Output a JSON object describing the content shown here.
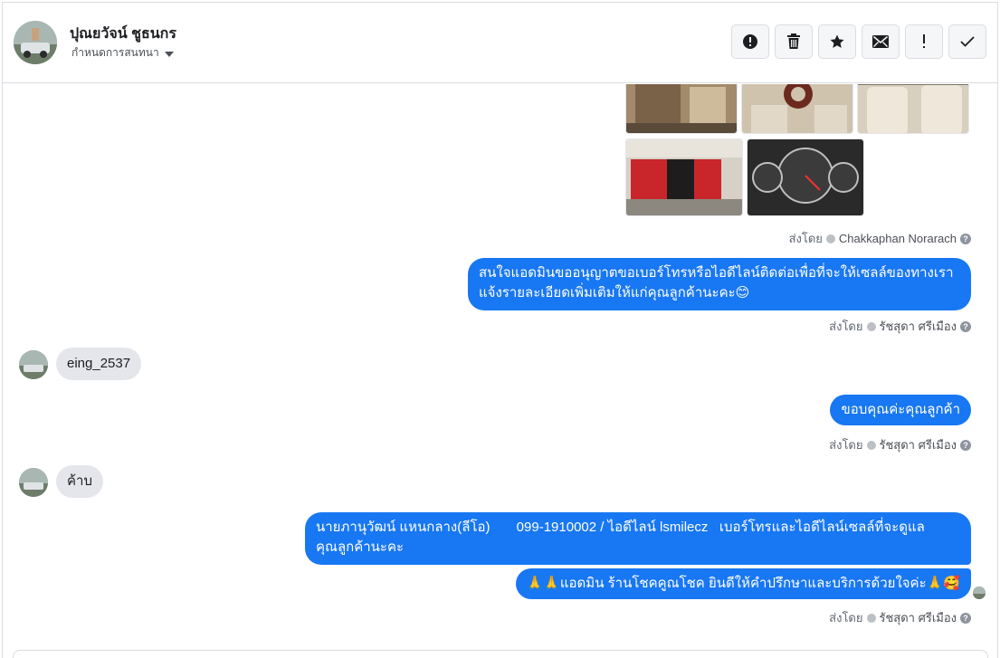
{
  "header": {
    "contact_name": "ปุณยวัจน์ ชูธนกร",
    "assign_label": "กำหนดการสนทนา"
  },
  "toolbar": {
    "buttons": [
      {
        "icon": "alert-circle-icon",
        "name": "mark-spam-button"
      },
      {
        "icon": "trash-icon",
        "name": "delete-button"
      },
      {
        "icon": "star-icon",
        "name": "star-button"
      },
      {
        "icon": "envelope-icon",
        "name": "mark-unread-button"
      },
      {
        "icon": "exclamation-icon",
        "name": "follow-up-button"
      },
      {
        "icon": "check-icon",
        "name": "mark-done-button"
      }
    ]
  },
  "thread": {
    "photo_sentby": {
      "prefix": "ส่งโดย",
      "agent": "Chakkaphan Norarach"
    },
    "msg1": {
      "line1": "สนใจแอดมินขออนุญาตขอเบอร์โทรหรือไอดีไลน์ติดต่อเพื่อที่จะให้เซลล์ของทางเรา",
      "line2": "แจ้งรายละเอียดเพิ่มเติมให้แก่คุณลูกค้านะคะ😊"
    },
    "msg1_sentby": {
      "prefix": "ส่งโดย",
      "agent": "รัชสุดา ศรีเมือง"
    },
    "in1": "eing_2537",
    "msg2": "ขอบคุณค่ะคุณลูกค้า",
    "msg2_sentby": {
      "prefix": "ส่งโดย",
      "agent": "รัชสุดา ศรีเมือง"
    },
    "in2": "ค้าบ",
    "msg3": {
      "line1": "นายภานุวัฒน์ แหนกลาง(ลีโอ)       099-1910002 / ไอดีไลน์ lsmilecz   เบอร์โทรและไอดีไลน์เซลล์ที่จะดูแล",
      "line2": "คุณลูกค้านะคะ"
    },
    "msg4": "🙏🙏แอดมิน ร้านโชคคูณโชค ยินดีให้คำปรึกษาและบริการด้วยใจค่ะ🙏🥰",
    "msg4_sentby": {
      "prefix": "ส่งโดย",
      "agent": "รัชสุดา ศรีเมือง"
    }
  },
  "colors": {
    "accent": "#1877f2",
    "incoming_bubble": "#e4e6eb",
    "border": "#dadde1"
  }
}
